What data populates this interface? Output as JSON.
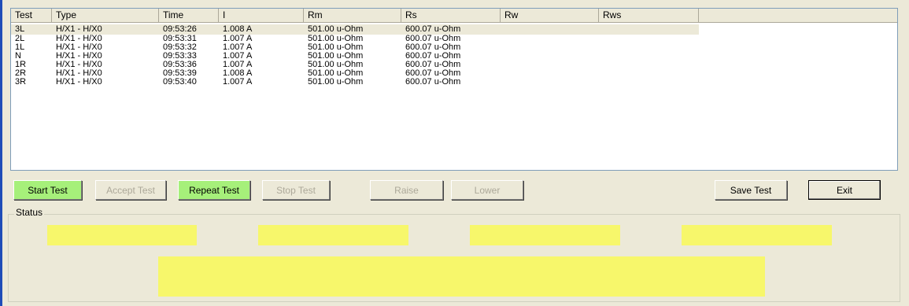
{
  "table": {
    "columns": [
      "Test",
      "Type",
      "Time",
      "I",
      "Rm",
      "Rs",
      "Rw",
      "Rws"
    ],
    "rows": [
      {
        "test": "3L",
        "type": "H/X1 - H/X0",
        "time": "09:53:26",
        "i": "1.008 A",
        "rm": "501.00 u-Ohm",
        "rs": "600.07 u-Ohm",
        "rw": "",
        "rws": ""
      },
      {
        "test": "2L",
        "type": "H/X1 - H/X0",
        "time": "09:53:31",
        "i": "1.007 A",
        "rm": "501.00 u-Ohm",
        "rs": "600.07 u-Ohm",
        "rw": "",
        "rws": ""
      },
      {
        "test": "1L",
        "type": "H/X1 - H/X0",
        "time": "09:53:32",
        "i": "1.007 A",
        "rm": "501.00 u-Ohm",
        "rs": "600.07 u-Ohm",
        "rw": "",
        "rws": ""
      },
      {
        "test": "N",
        "type": "H/X1 - H/X0",
        "time": "09:53:33",
        "i": "1.007 A",
        "rm": "501.00 u-Ohm",
        "rs": "600.07 u-Ohm",
        "rw": "",
        "rws": ""
      },
      {
        "test": "1R",
        "type": "H/X1 - H/X0",
        "time": "09:53:36",
        "i": "1.007 A",
        "rm": "501.00 u-Ohm",
        "rs": "600.07 u-Ohm",
        "rw": "",
        "rws": ""
      },
      {
        "test": "2R",
        "type": "H/X1 - H/X0",
        "time": "09:53:39",
        "i": "1.008 A",
        "rm": "501.00 u-Ohm",
        "rs": "600.07 u-Ohm",
        "rw": "",
        "rws": ""
      },
      {
        "test": "3R",
        "type": "H/X1 - H/X0",
        "time": "09:53:40",
        "i": "1.007 A",
        "rm": "501.00 u-Ohm",
        "rs": "600.07 u-Ohm",
        "rw": "",
        "rws": ""
      }
    ],
    "selected_row": 0
  },
  "buttons": {
    "start_test": "Start Test",
    "accept_test": "Accept Test",
    "repeat_test": "Repeat Test",
    "stop_test": "Stop Test",
    "raise": "Raise",
    "lower": "Lower",
    "save_test": "Save Test",
    "exit": "Exit"
  },
  "status": {
    "label": "Status",
    "indicator_color": "#f7f76b"
  },
  "colors": {
    "window_bg": "#ece9d8",
    "active_button": "#a6f07a",
    "accent": "#1f4db8"
  }
}
